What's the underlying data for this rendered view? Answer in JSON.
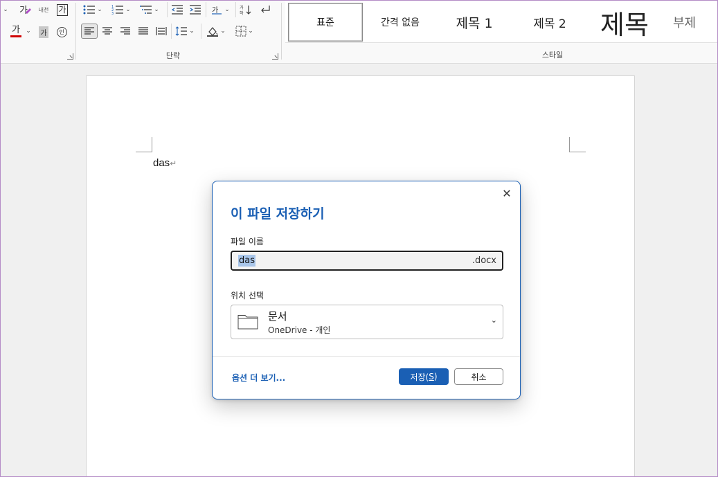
{
  "ribbon": {
    "font_group": {
      "launcher_icon": "dialog-launcher-icon",
      "row1": [
        {
          "name": "clear-formatting-icon",
          "glyph": "가"
        },
        {
          "name": "phonetic-guide-icon",
          "glyph": "내천"
        },
        {
          "name": "character-border-icon",
          "glyph": "가"
        }
      ],
      "row2": [
        {
          "name": "font-color-icon",
          "glyph": "가",
          "color": "#d00000"
        },
        {
          "name": "character-shading-icon",
          "glyph": "가"
        },
        {
          "name": "enclose-characters-icon",
          "glyph": "인"
        }
      ]
    },
    "paragraph_group": {
      "label": "단락"
    },
    "styles_group": {
      "label": "스타일",
      "items": [
        {
          "label": "표준",
          "selected": true
        },
        {
          "label": "간격 없음"
        },
        {
          "label": "제목 1"
        },
        {
          "label": "제목 2"
        },
        {
          "label": "제목"
        },
        {
          "label": "부제"
        }
      ]
    }
  },
  "document": {
    "text": "das",
    "para_mark": "↵"
  },
  "dialog": {
    "title": "이 파일 저장하기",
    "close_glyph": "✕",
    "filename_label": "파일 이름",
    "filename_value": "das",
    "filename_ext": ".docx",
    "location_label": "위치 선택",
    "location_name": "문서",
    "location_sub": "OneDrive - 개인",
    "location_chevron": "⌄",
    "more_options": "옵션 더 보기...",
    "save_label_main": "저장(",
    "save_label_key": "S",
    "save_label_end": ")",
    "cancel_label": "취소"
  },
  "colors": {
    "accent": "#1a5fb4",
    "selection": "#a9c6ea",
    "font_color_bar": "#d00000"
  }
}
